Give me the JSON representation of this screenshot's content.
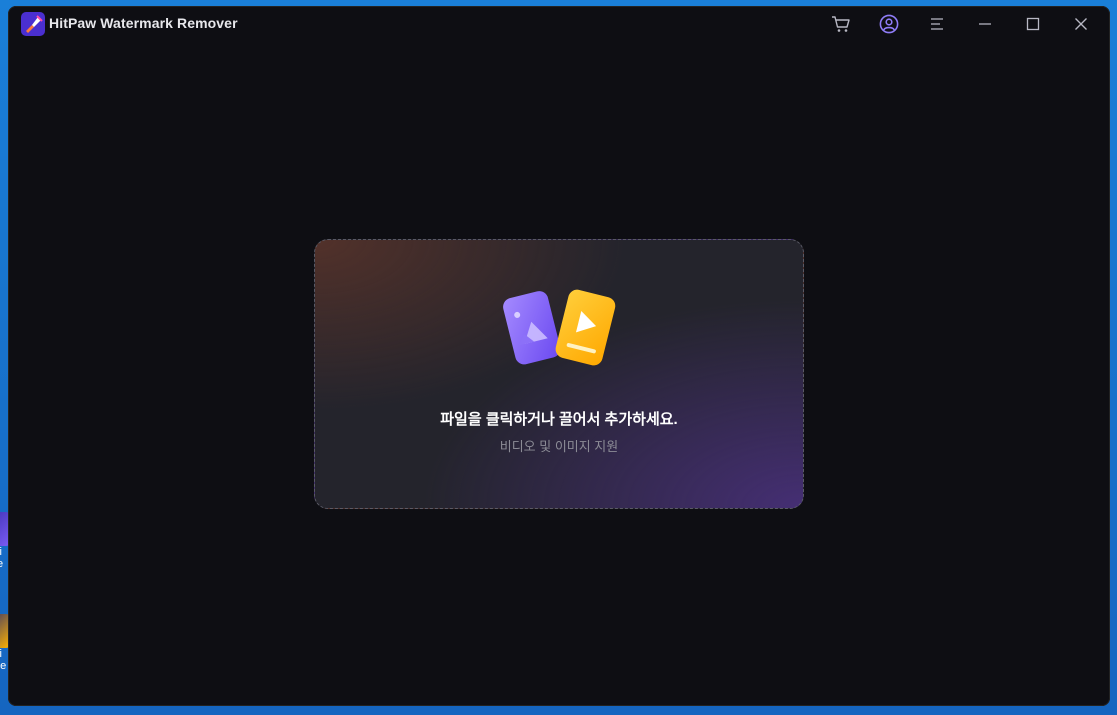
{
  "app": {
    "title": "HitPaw Watermark Remover"
  },
  "titlebar": {
    "icons": [
      "cart-icon",
      "account-icon",
      "menu-icon",
      "minimize-icon",
      "maximize-icon",
      "close-icon"
    ]
  },
  "dropzone": {
    "main_text": "파일을 클릭하거나 끌어서 추가하세요.",
    "sub_text": "비디오 및 이미지 지원"
  },
  "desktop": {
    "icons": [
      {
        "label_line1": "iti",
        "label_line2": "te"
      },
      {
        "label_line1": "iti",
        "label_line2": "de"
      }
    ]
  },
  "colors": {
    "accent_purple": "#7b5cf5",
    "accent_yellow": "#ffb300",
    "window_bg": "#0e0e13"
  }
}
